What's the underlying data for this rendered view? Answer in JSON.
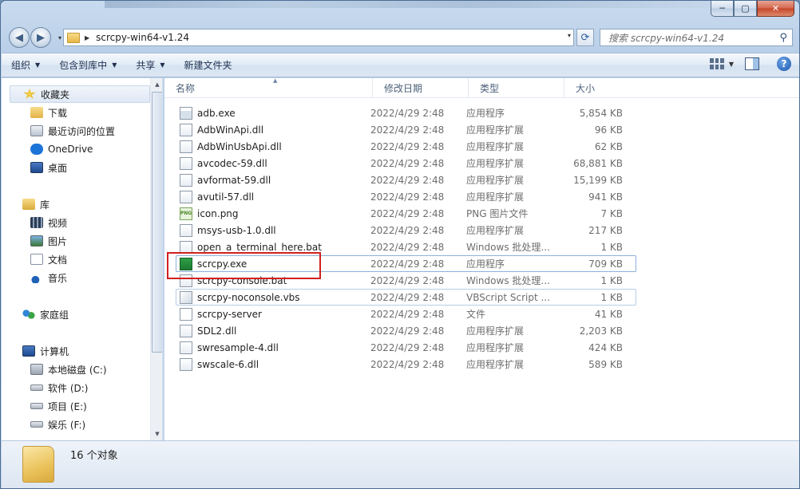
{
  "window": {
    "minimize_label": "─",
    "maximize_label": "▢",
    "close_label": "✕"
  },
  "nav": {
    "back_glyph": "◀",
    "forward_glyph": "▶",
    "history_glyph": "▾",
    "refresh_glyph": "⟳"
  },
  "address": {
    "path": "scrcpy-win64-v1.24",
    "crumb_glyph": "▶",
    "drop_glyph": "▾"
  },
  "search": {
    "placeholder": "搜索 scrcpy-win64-v1.24",
    "icon": "search-icon",
    "glyph": "⚲"
  },
  "toolbar": {
    "organize": "组织",
    "include_in_library": "包含到库中",
    "share": "共享",
    "new_folder": "新建文件夹",
    "dropdown_glyph": "▼",
    "help_glyph": "?"
  },
  "sidebar": {
    "favorites": {
      "label": "收藏夹",
      "icon": "star-icon"
    },
    "favorites_items": [
      {
        "label": "下载",
        "icon": "download-folder-icon"
      },
      {
        "label": "最近访问的位置",
        "icon": "recent-places-icon"
      },
      {
        "label": "OneDrive",
        "icon": "onedrive-cloud-icon"
      },
      {
        "label": "桌面",
        "icon": "desktop-icon"
      }
    ],
    "libraries": {
      "label": "库",
      "icon": "library-icon"
    },
    "library_items": [
      {
        "label": "视频",
        "icon": "video-library-icon"
      },
      {
        "label": "图片",
        "icon": "pictures-library-icon"
      },
      {
        "label": "文档",
        "icon": "documents-library-icon"
      },
      {
        "label": "音乐",
        "icon": "music-library-icon"
      }
    ],
    "homegroup": {
      "label": "家庭组",
      "icon": "homegroup-icon"
    },
    "computer": {
      "label": "计算机",
      "icon": "computer-icon"
    },
    "computer_items": [
      {
        "label": "本地磁盘 (C:)",
        "icon": "system-drive-icon"
      },
      {
        "label": "软件 (D:)",
        "icon": "drive-icon"
      },
      {
        "label": "项目 (E:)",
        "icon": "drive-icon"
      },
      {
        "label": "娱乐 (F:)",
        "icon": "drive-icon"
      }
    ],
    "scroll_up_glyph": "▲",
    "scroll_down_glyph": "▼"
  },
  "columns": {
    "name": "名称",
    "modified": "修改日期",
    "type": "类型",
    "size": "大小",
    "sort_glyph": "▲"
  },
  "files": [
    {
      "name": "adb.exe",
      "modified": "2022/4/29 2:48",
      "type": "应用程序",
      "size": "5,854 KB",
      "icon": "exe-file-icon"
    },
    {
      "name": "AdbWinApi.dll",
      "modified": "2022/4/29 2:48",
      "type": "应用程序扩展",
      "size": "96 KB",
      "icon": "dll-file-icon"
    },
    {
      "name": "AdbWinUsbApi.dll",
      "modified": "2022/4/29 2:48",
      "type": "应用程序扩展",
      "size": "62 KB",
      "icon": "dll-file-icon"
    },
    {
      "name": "avcodec-59.dll",
      "modified": "2022/4/29 2:48",
      "type": "应用程序扩展",
      "size": "68,881 KB",
      "icon": "dll-file-icon"
    },
    {
      "name": "avformat-59.dll",
      "modified": "2022/4/29 2:48",
      "type": "应用程序扩展",
      "size": "15,199 KB",
      "icon": "dll-file-icon"
    },
    {
      "name": "avutil-57.dll",
      "modified": "2022/4/29 2:48",
      "type": "应用程序扩展",
      "size": "941 KB",
      "icon": "dll-file-icon"
    },
    {
      "name": "icon.png",
      "modified": "2022/4/29 2:48",
      "type": "PNG 图片文件",
      "size": "7 KB",
      "icon": "png-file-icon",
      "icon_text": "PNG"
    },
    {
      "name": "msys-usb-1.0.dll",
      "modified": "2022/4/29 2:48",
      "type": "应用程序扩展",
      "size": "217 KB",
      "icon": "dll-file-icon"
    },
    {
      "name": "open_a_terminal_here.bat",
      "modified": "2022/4/29 2:48",
      "type": "Windows 批处理...",
      "size": "1 KB",
      "icon": "bat-file-icon"
    },
    {
      "name": "scrcpy.exe",
      "modified": "2022/4/29 2:48",
      "type": "应用程序",
      "size": "709 KB",
      "icon": "scrcpy-app-icon"
    },
    {
      "name": "scrcpy-console.bat",
      "modified": "2022/4/29 2:48",
      "type": "Windows 批处理...",
      "size": "1 KB",
      "icon": "bat-file-icon"
    },
    {
      "name": "scrcpy-noconsole.vbs",
      "modified": "2022/4/29 2:48",
      "type": "VBScript Script ...",
      "size": "1 KB",
      "icon": "vbs-file-icon"
    },
    {
      "name": "scrcpy-server",
      "modified": "2022/4/29 2:48",
      "type": "文件",
      "size": "41 KB",
      "icon": "generic-file-icon"
    },
    {
      "name": "SDL2.dll",
      "modified": "2022/4/29 2:48",
      "type": "应用程序扩展",
      "size": "2,203 KB",
      "icon": "dll-file-icon"
    },
    {
      "name": "swresample-4.dll",
      "modified": "2022/4/29 2:48",
      "type": "应用程序扩展",
      "size": "424 KB",
      "icon": "dll-file-icon"
    },
    {
      "name": "swscale-6.dll",
      "modified": "2022/4/29 2:48",
      "type": "应用程序扩展",
      "size": "589 KB",
      "icon": "dll-file-icon"
    }
  ],
  "status": {
    "item_count": "16 个对象"
  },
  "colors": {
    "highlight_border": "#8bb2dc",
    "annotation_box": "#d12020"
  }
}
